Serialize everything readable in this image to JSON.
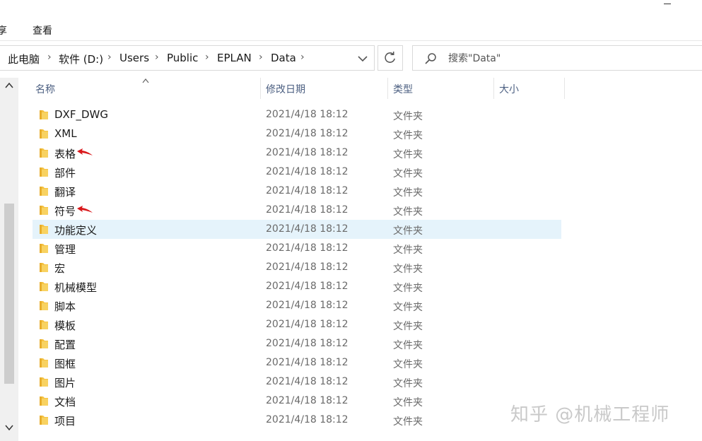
{
  "ribbon": {
    "tabs": [
      "享",
      "查看"
    ]
  },
  "address": {
    "crumbs": [
      "此电脑",
      "软件 (D:)",
      "Users",
      "Public",
      "EPLAN",
      "Data"
    ]
  },
  "search": {
    "placeholder": "搜索\"Data\""
  },
  "columns": {
    "name": "名称",
    "date": "修改日期",
    "type": "类型",
    "size": "大小"
  },
  "rows": [
    {
      "name": "DXF_DWG",
      "date": "2021/4/18 18:12",
      "type": "文件夹"
    },
    {
      "name": "XML",
      "date": "2021/4/18 18:12",
      "type": "文件夹"
    },
    {
      "name": "表格",
      "date": "2021/4/18 18:12",
      "type": "文件夹",
      "annotated": true
    },
    {
      "name": "部件",
      "date": "2021/4/18 18:12",
      "type": "文件夹"
    },
    {
      "name": "翻译",
      "date": "2021/4/18 18:12",
      "type": "文件夹"
    },
    {
      "name": "符号",
      "date": "2021/4/18 18:12",
      "type": "文件夹",
      "annotated": true
    },
    {
      "name": "功能定义",
      "date": "2021/4/18 18:12",
      "type": "文件夹",
      "selected": true
    },
    {
      "name": "管理",
      "date": "2021/4/18 18:12",
      "type": "文件夹"
    },
    {
      "name": "宏",
      "date": "2021/4/18 18:12",
      "type": "文件夹"
    },
    {
      "name": "机械模型",
      "date": "2021/4/18 18:12",
      "type": "文件夹"
    },
    {
      "name": "脚本",
      "date": "2021/4/18 18:12",
      "type": "文件夹"
    },
    {
      "name": "模板",
      "date": "2021/4/18 18:12",
      "type": "文件夹"
    },
    {
      "name": "配置",
      "date": "2021/4/18 18:12",
      "type": "文件夹"
    },
    {
      "name": "图框",
      "date": "2021/4/18 18:12",
      "type": "文件夹"
    },
    {
      "name": "图片",
      "date": "2021/4/18 18:12",
      "type": "文件夹"
    },
    {
      "name": "文档",
      "date": "2021/4/18 18:12",
      "type": "文件夹"
    },
    {
      "name": "项目",
      "date": "2021/4/18 18:12",
      "type": "文件夹"
    }
  ],
  "watermark": "知乎 @机械工程师",
  "colors": {
    "folder": "#f5c342",
    "selected_row": "#e5f3fb",
    "annotation_arrow": "#d9191c",
    "header_text": "#4d6082"
  },
  "icons": {
    "folder": "folder-icon",
    "search": "search-icon",
    "refresh": "refresh-icon",
    "chevron": "chevron-down-icon",
    "arrow": "red-arrow-icon"
  }
}
